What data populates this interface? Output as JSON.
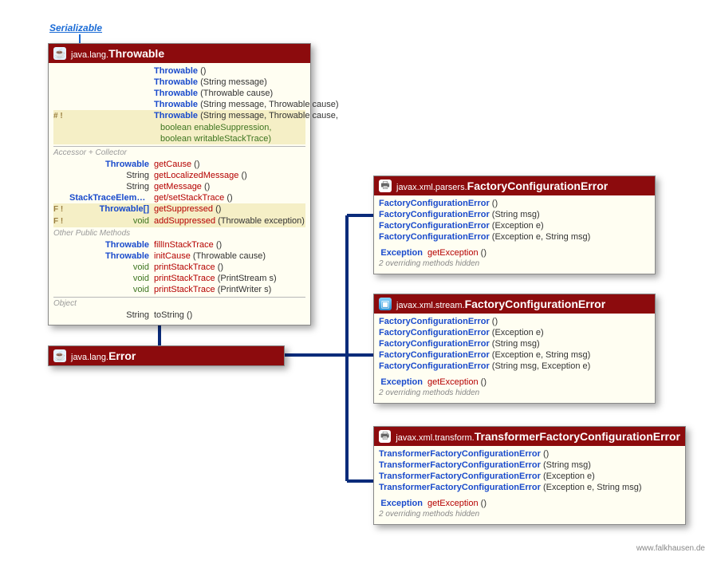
{
  "interface": {
    "label": "Serializable"
  },
  "credit": "www.falkhausen.de",
  "throwable": {
    "pkg": "java.lang.",
    "name": "Throwable",
    "ctors": [
      {
        "name": "Throwable",
        "params": "()"
      },
      {
        "name": "Throwable",
        "params": "(String message)"
      },
      {
        "name": "Throwable",
        "params": "(Throwable cause)"
      },
      {
        "name": "Throwable",
        "params": "(String message, Throwable cause)"
      },
      {
        "mods": "# !",
        "name": "Throwable",
        "params_line1": "(String message, Throwable cause,",
        "params_line2": "boolean enableSuppression,",
        "params_line3": "boolean writableStackTrace)"
      }
    ],
    "acc_label": "Accessor + Collector",
    "acc": [
      {
        "ret": "Throwable",
        "name": "getCause",
        "params": "()"
      },
      {
        "ret": "String",
        "name": "getLocalizedMessage",
        "params": "()"
      },
      {
        "ret": "String",
        "name": "getMessage",
        "params": "()"
      },
      {
        "ret": "StackTraceElement[]",
        "name": "get/setStackTrace",
        "params": "()"
      },
      {
        "mods": "F !",
        "ret": "Throwable[]",
        "name": "getSuppressed",
        "params": "()"
      },
      {
        "mods": "F !",
        "ret": "void",
        "name": "addSuppressed",
        "params": "(Throwable exception)"
      }
    ],
    "other_label": "Other Public Methods",
    "other": [
      {
        "ret": "Throwable",
        "name": "fillInStackTrace",
        "params": "()"
      },
      {
        "ret": "Throwable",
        "name": "initCause",
        "params": "(Throwable cause)"
      },
      {
        "ret": "void",
        "name": "printStackTrace",
        "params": "()"
      },
      {
        "ret": "void",
        "name": "printStackTrace",
        "params": "(PrintStream s)"
      },
      {
        "ret": "void",
        "name": "printStackTrace",
        "params": "(PrintWriter s)"
      }
    ],
    "obj_label": "Object",
    "obj": [
      {
        "ret": "String",
        "name": "toString",
        "params": "()"
      }
    ]
  },
  "error": {
    "pkg": "java.lang.",
    "name": "Error"
  },
  "fce_parsers": {
    "pkg": "javax.xml.parsers.",
    "name": "FactoryConfigurationError",
    "ctors": [
      {
        "name": "FactoryConfigurationError",
        "params": "()"
      },
      {
        "name": "FactoryConfigurationError",
        "params": "(String msg)"
      },
      {
        "name": "FactoryConfigurationError",
        "params": "(Exception e)"
      },
      {
        "name": "FactoryConfigurationError",
        "params": "(Exception e, String msg)"
      }
    ],
    "methods": [
      {
        "ret": "Exception",
        "name": "getException",
        "params": "()"
      }
    ],
    "hidden": "2 overriding methods hidden"
  },
  "fce_stream": {
    "pkg": "javax.xml.stream.",
    "name": "FactoryConfigurationError",
    "ctors": [
      {
        "name": "FactoryConfigurationError",
        "params": "()"
      },
      {
        "name": "FactoryConfigurationError",
        "params": "(Exception e)"
      },
      {
        "name": "FactoryConfigurationError",
        "params": "(String msg)"
      },
      {
        "name": "FactoryConfigurationError",
        "params": "(Exception e, String msg)"
      },
      {
        "name": "FactoryConfigurationError",
        "params": "(String msg, Exception e)"
      }
    ],
    "methods": [
      {
        "ret": "Exception",
        "name": "getException",
        "params": "()"
      }
    ],
    "hidden": "2 overriding methods hidden"
  },
  "tfce": {
    "pkg": "javax.xml.transform.",
    "name": "TransformerFactoryConfigurationError",
    "ctors": [
      {
        "name": "TransformerFactoryConfigurationError",
        "params": "()"
      },
      {
        "name": "TransformerFactoryConfigurationError",
        "params": "(String msg)"
      },
      {
        "name": "TransformerFactoryConfigurationError",
        "params": "(Exception e)"
      },
      {
        "name": "TransformerFactoryConfigurationError",
        "params": "(Exception e, String msg)"
      }
    ],
    "methods": [
      {
        "ret": "Exception",
        "name": "getException",
        "params": "()"
      }
    ],
    "hidden": "2 overriding methods hidden"
  }
}
